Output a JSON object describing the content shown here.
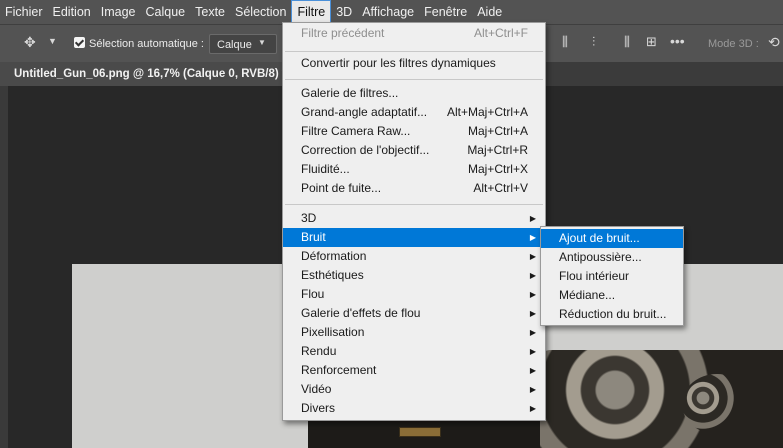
{
  "menubar": {
    "items": [
      "Fichier",
      "Edition",
      "Image",
      "Calque",
      "Texte",
      "Sélection",
      "Filtre",
      "3D",
      "Affichage",
      "Fenêtre",
      "Aide"
    ]
  },
  "options": {
    "auto_select_label": "Sélection automatique :",
    "auto_select_value": "Calque",
    "mode_3d_label": "Mode 3D :"
  },
  "document": {
    "tab_title": "Untitled_Gun_06.png @ 16,7% (Calque 0, RVB/8) *"
  },
  "filter_menu": {
    "last_filter": {
      "label": "Filtre précédent",
      "shortcut": "Alt+Ctrl+F"
    },
    "smart_filters": {
      "label": "Convertir pour les filtres dynamiques"
    },
    "gallery_items": [
      {
        "label": "Galerie de filtres...",
        "shortcut": ""
      },
      {
        "label": "Grand-angle adaptatif...",
        "shortcut": "Alt+Maj+Ctrl+A"
      },
      {
        "label": "Filtre Camera Raw...",
        "shortcut": "Maj+Ctrl+A"
      },
      {
        "label": "Correction de l'objectif...",
        "shortcut": "Maj+Ctrl+R"
      },
      {
        "label": "Fluidité...",
        "shortcut": "Maj+Ctrl+X"
      },
      {
        "label": "Point de fuite...",
        "shortcut": "Alt+Ctrl+V"
      }
    ],
    "categories": [
      "3D",
      "Bruit",
      "Déformation",
      "Esthétiques",
      "Flou",
      "Galerie d'effets de flou",
      "Pixellisation",
      "Rendu",
      "Renforcement",
      "Vidéo",
      "Divers"
    ],
    "highlighted_category": "Bruit"
  },
  "noise_submenu": {
    "items": [
      "Ajout de bruit...",
      "Antipoussière...",
      "Flou intérieur",
      "Médiane...",
      "Réduction du bruit..."
    ],
    "highlighted": "Ajout de bruit..."
  },
  "colors": {
    "menu_highlight": "#0078d7",
    "menubar_bg": "#535353",
    "menu_bg": "#efefef"
  }
}
